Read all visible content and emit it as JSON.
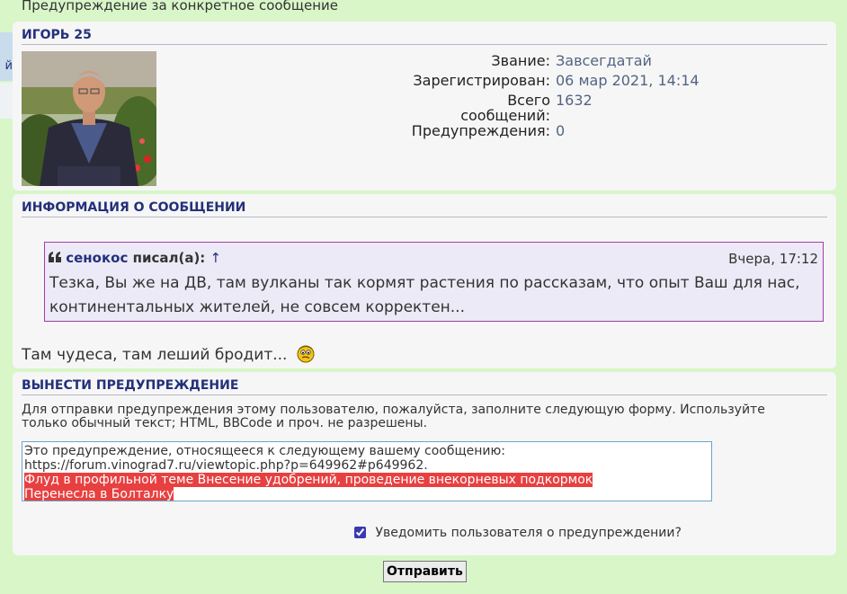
{
  "page": {
    "heading": "Предупреждение за конкретное сообщение",
    "side_tab_text": "й"
  },
  "user_panel": {
    "username": "ИГОРЬ 25",
    "rank_label": "Звание:",
    "rank_value": "Завсегдатай",
    "registered_label": "Зарегистрирован:",
    "registered_value": "06 мар 2021, 14:14",
    "posts_label_line1": "Всего",
    "posts_label_line2": "сообщений:",
    "posts_value": "1632",
    "warnings_label": "Предупреждения:",
    "warnings_value": "0"
  },
  "message_panel": {
    "title": "ИНФОРМАЦИЯ О СООБЩЕНИИ",
    "quote": {
      "author": "сенокос",
      "wrote": "писал(а):",
      "arrow": "↑",
      "time": "Вчера, 17:12",
      "line1": "Тезка, Вы же на ДВ, там вулканы так кормят растения по рассказам, что опыт Ваш для нас,",
      "line2": "континентальных жителей, не совсем корректен..."
    },
    "post_text": "Там чудеса, там леший бродит..."
  },
  "warning_panel": {
    "title": "ВЫНЕСТИ ПРЕДУПРЕЖДЕНИЕ",
    "instructions": "Для отправки предупреждения этому пользователю, пожалуйста, заполните следующую форму. Используйте только обычный текст; HTML, BBCode и проч. не разрешены.",
    "text_line1": "Это предупреждение, относящееся к следующему вашему сообщению:",
    "text_line2": "https://forum.vinograd7.ru/viewtopic.php?p=649962#p649962.",
    "text_line3": "Флуд в профильной теме  Внесение удобрений, проведение внекорневых подкормок",
    "text_line4": "Перенесла в Болталку",
    "notify_label": "Уведомить пользователя о предупреждении?",
    "notify_checked": true,
    "submit_label": "Отправить"
  },
  "colors": {
    "page_bg": "#d8f6c8",
    "panel_bg": "#f6f6f6",
    "title": "#23307a",
    "link": "#536482",
    "quote_border": "#a23ea8",
    "selection": "#e84040"
  }
}
